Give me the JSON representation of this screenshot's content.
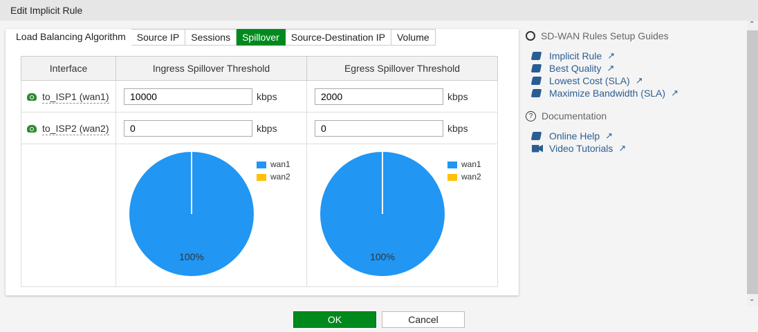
{
  "title": "Edit Implicit Rule",
  "tabs": [
    "Load Balancing Algorithm",
    "Source IP",
    "Sessions",
    "Spillover",
    "Source-Destination IP",
    "Volume"
  ],
  "table": {
    "headers": [
      "Interface",
      "Ingress Spillover Threshold",
      "Egress Spillover Threshold"
    ],
    "rows": [
      {
        "interface": "to_ISP1 (wan1)",
        "ingress": "10000",
        "egress": "2000",
        "unit": "kbps"
      },
      {
        "interface": "to_ISP2 (wan2)",
        "ingress": "0",
        "egress": "0",
        "unit": "kbps"
      }
    ]
  },
  "chart_data": [
    {
      "type": "pie",
      "title": "Ingress",
      "categories": [
        "wan1",
        "wan2"
      ],
      "values": [
        100,
        0
      ],
      "colors": [
        "#2196f3",
        "#ffc107"
      ],
      "label": "100%"
    },
    {
      "type": "pie",
      "title": "Egress",
      "categories": [
        "wan1",
        "wan2"
      ],
      "values": [
        100,
        0
      ],
      "colors": [
        "#2196f3",
        "#ffc107"
      ],
      "label": "100%"
    }
  ],
  "side": {
    "guides_title": "SD-WAN Rules Setup Guides",
    "guides": [
      "Implicit Rule",
      "Best Quality",
      "Lowest Cost (SLA)",
      "Maximize Bandwidth (SLA)"
    ],
    "doc_title": "Documentation",
    "docs": [
      "Online Help",
      "Video Tutorials"
    ]
  },
  "buttons": {
    "ok": "OK",
    "cancel": "Cancel"
  }
}
